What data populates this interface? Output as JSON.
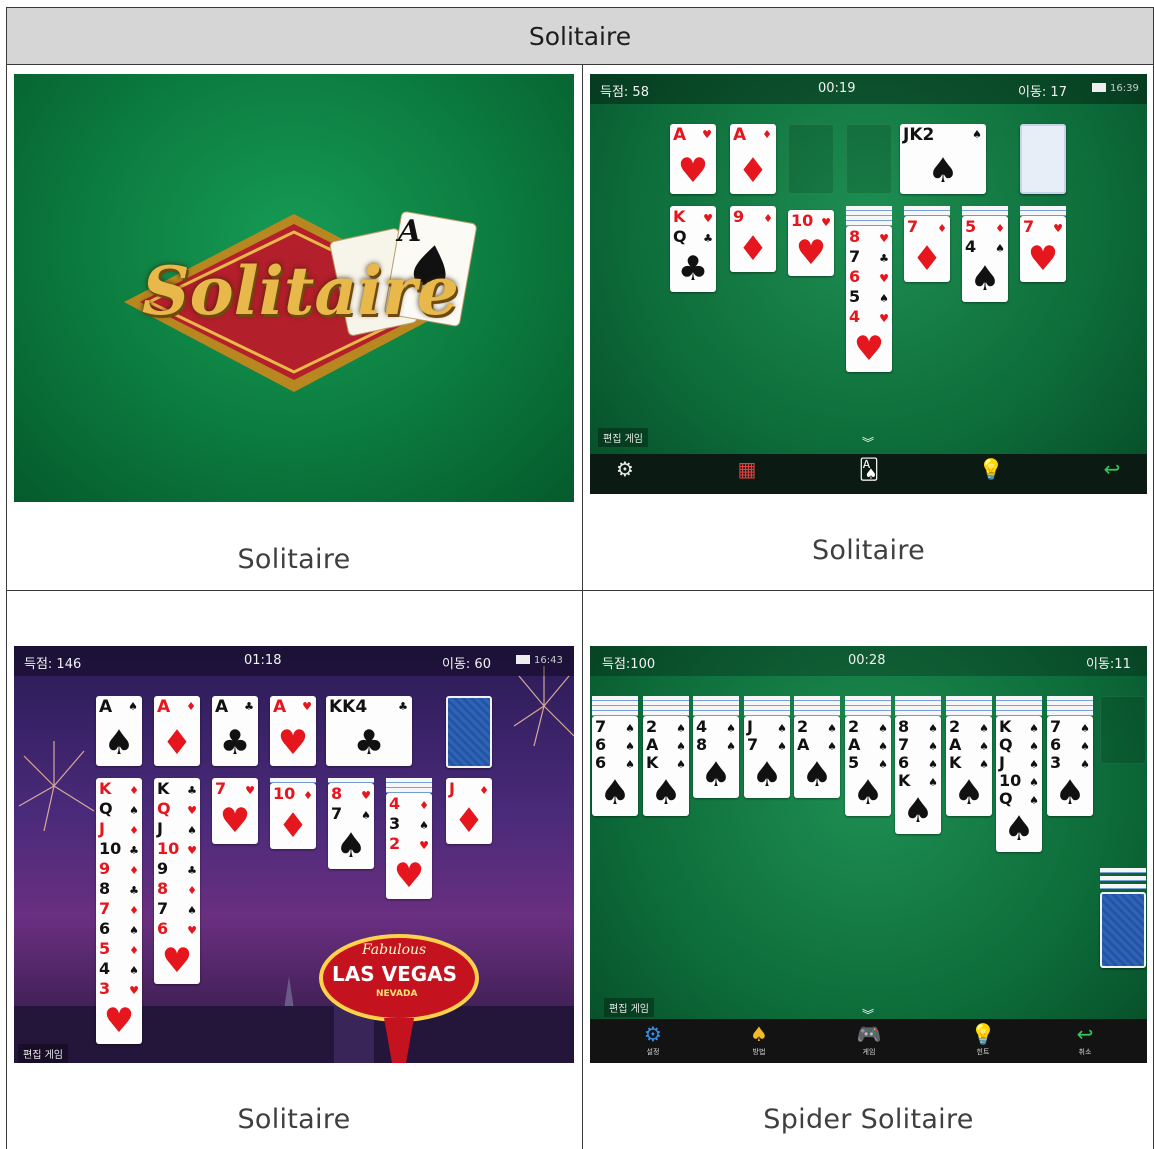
{
  "header": {
    "title": "Solitaire"
  },
  "cells": [
    {
      "caption": "Solitaire"
    },
    {
      "caption": "Solitaire"
    },
    {
      "caption": "Solitaire"
    },
    {
      "caption": "Spider Solitaire"
    }
  ],
  "shot1": {
    "logo": "Solitaire",
    "card_rank": "A"
  },
  "shot2": {
    "score": "득점: 58",
    "time": "00:19",
    "moves": "이동: 17",
    "clock": "16:39",
    "tip": "편집 게임",
    "foundation": [
      {
        "rank": "A",
        "suit": "♥",
        "color": "red"
      },
      {
        "rank": "A",
        "suit": "♦",
        "color": "red"
      },
      {
        "rank": "JK2",
        "suit": "♠",
        "color": "black"
      }
    ],
    "tableau": [
      {
        "ranks": [
          "K",
          "Q"
        ],
        "suits": [
          "♥",
          "♣"
        ],
        "big": "♣",
        "colors": [
          "red",
          "black"
        ]
      },
      {
        "ranks": [
          "9"
        ],
        "suits": [
          "♦"
        ],
        "big": "♦",
        "colors": [
          "red"
        ]
      },
      {
        "ranks": [
          "10"
        ],
        "suits": [
          "♥"
        ],
        "big": "♥",
        "colors": [
          "red"
        ]
      },
      {
        "ranks": [
          "8",
          "7",
          "6",
          "5",
          "4"
        ],
        "suits": [
          "♥",
          "♣",
          "♥",
          "♠",
          "♥"
        ],
        "big": "♥",
        "colors": [
          "red",
          "black",
          "red",
          "black",
          "red"
        ]
      },
      {
        "ranks": [
          "7"
        ],
        "suits": [
          "♦"
        ],
        "big": "♦",
        "colors": [
          "red"
        ]
      },
      {
        "ranks": [
          "5",
          "4"
        ],
        "suits": [
          "♦",
          "♠"
        ],
        "big": "♠",
        "colors": [
          "red",
          "black"
        ]
      },
      {
        "ranks": [
          "7"
        ],
        "suits": [
          "♥"
        ],
        "big": "♥",
        "colors": [
          "red"
        ]
      }
    ],
    "toolbar_icons": [
      "gear-icon",
      "calendar-icon",
      "cards-icon",
      "lightbulb-icon",
      "undo-icon"
    ]
  },
  "shot3": {
    "score": "득점: 146",
    "time": "01:18",
    "moves": "이동: 60",
    "clock": "16:43",
    "tip": "편집 게임",
    "foundation": [
      {
        "rank": "A",
        "suit": "♠",
        "color": "black"
      },
      {
        "rank": "A",
        "suit": "♦",
        "color": "red"
      },
      {
        "rank": "A",
        "suit": "♣",
        "color": "black"
      },
      {
        "rank": "A",
        "suit": "♥",
        "color": "red"
      },
      {
        "rank": "KK4",
        "suit": "♣",
        "color": "black"
      }
    ],
    "tableau": [
      {
        "ranks": [
          "K",
          "Q",
          "J",
          "10",
          "9",
          "8",
          "7",
          "6",
          "5",
          "4",
          "3"
        ],
        "suits": [
          "♦",
          "♠",
          "♦",
          "♣",
          "♦",
          "♣",
          "♦",
          "♠",
          "♦",
          "♠",
          "♥"
        ],
        "big": "♥",
        "colors": [
          "red",
          "black",
          "red",
          "black",
          "red",
          "black",
          "red",
          "black",
          "red",
          "black",
          "red"
        ]
      },
      {
        "ranks": [
          "K",
          "Q",
          "J",
          "10",
          "9",
          "8",
          "7",
          "6"
        ],
        "suits": [
          "♣",
          "♥",
          "♠",
          "♥",
          "♣",
          "♦",
          "♠",
          "♥"
        ],
        "big": "♥",
        "colors": [
          "black",
          "red",
          "black",
          "red",
          "black",
          "red",
          "black",
          "red"
        ]
      },
      {
        "ranks": [
          "7"
        ],
        "suits": [
          "♥"
        ],
        "big": "♥",
        "colors": [
          "red"
        ]
      },
      {
        "ranks": [
          "10"
        ],
        "suits": [
          "♦"
        ],
        "big": "♦",
        "colors": [
          "red"
        ]
      },
      {
        "ranks": [
          "8",
          "7"
        ],
        "suits": [
          "♥",
          "♠"
        ],
        "big": "♠",
        "colors": [
          "red",
          "black"
        ]
      },
      {
        "ranks": [
          "4",
          "3",
          "2"
        ],
        "suits": [
          "♦",
          "♠",
          "♥"
        ],
        "big": "♥",
        "colors": [
          "red",
          "black",
          "red"
        ]
      },
      {
        "ranks": [
          "J"
        ],
        "suits": [
          "♦"
        ],
        "big": "♦",
        "colors": [
          "red"
        ]
      }
    ],
    "sign": {
      "line1": "Fabulous",
      "line2": "LAS VEGAS",
      "line3": "NEVADA"
    }
  },
  "shot4": {
    "score": "득점:100",
    "time": "00:28",
    "moves": "이동:11",
    "tip": "편집 게임",
    "columns": [
      {
        "ranks": [
          "7",
          "6",
          "6"
        ],
        "big": "♠"
      },
      {
        "ranks": [
          "2",
          "A",
          "K"
        ],
        "big": "♠"
      },
      {
        "ranks": [
          "4",
          "8"
        ],
        "big": "♠"
      },
      {
        "ranks": [
          "J",
          "7"
        ],
        "big": "♠"
      },
      {
        "ranks": [
          "2",
          "A"
        ],
        "big": "♠"
      },
      {
        "ranks": [
          "2",
          "A",
          "5"
        ],
        "big": "♠"
      },
      {
        "ranks": [
          "8",
          "7",
          "6",
          "K"
        ],
        "big": "♠"
      },
      {
        "ranks": [
          "2",
          "A",
          "K"
        ],
        "big": "♠"
      },
      {
        "ranks": [
          "K",
          "Q",
          "J",
          "10",
          "Q"
        ],
        "big": "♠"
      },
      {
        "ranks": [
          "7",
          "6",
          "3"
        ],
        "big": "♠"
      }
    ],
    "toolbar": [
      {
        "icon": "gear-icon",
        "label": "설정"
      },
      {
        "icon": "spade-icon",
        "label": "방법"
      },
      {
        "icon": "gamepad-icon",
        "label": "게임"
      },
      {
        "icon": "lightbulb-icon",
        "label": "힌트"
      },
      {
        "icon": "undo-icon",
        "label": "취소"
      }
    ]
  },
  "colors": {
    "felt": "#0b7a3e",
    "header_bg": "#d6d6d6",
    "card_red": "#e5161d"
  }
}
